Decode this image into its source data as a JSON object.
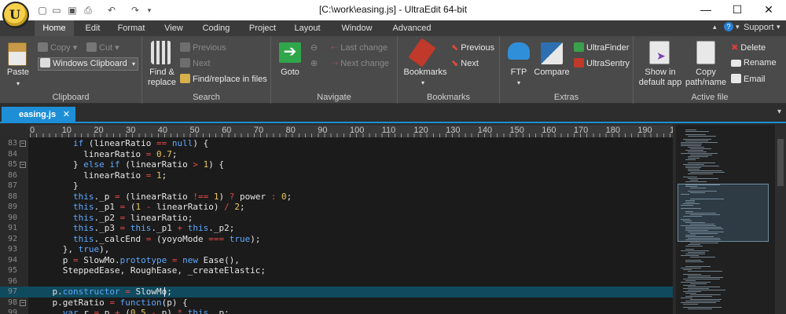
{
  "title_bar": {
    "title": "[C:\\work\\easing.js] - UltraEdit 64-bit",
    "app_logo_text": "U"
  },
  "ribbon_tabs": [
    "Home",
    "Edit",
    "Format",
    "View",
    "Coding",
    "Project",
    "Layout",
    "Window",
    "Advanced"
  ],
  "help": {
    "label": "?",
    "support": "Support"
  },
  "clipboard": {
    "paste": "Paste",
    "copy": "Copy",
    "cut": "Cut",
    "clipboard_select": "Windows Clipboard",
    "group": "Clipboard"
  },
  "search": {
    "find_replace_1": "Find &",
    "find_replace_2": "replace",
    "previous": "Previous",
    "next": "Next",
    "find_in_files": "Find/replace in files",
    "group": "Search"
  },
  "navigate": {
    "goto": "Goto",
    "last_change": "Last change",
    "next_change": "Next change",
    "group": "Navigate"
  },
  "bookmarks": {
    "bookmarks": "Bookmarks",
    "previous": "Previous",
    "next": "Next",
    "group": "Bookmarks"
  },
  "extras": {
    "ftp": "FTP",
    "compare": "Compare",
    "ultrafinder": "UltraFinder",
    "ultrasentry": "UltraSentry",
    "group": "Extras"
  },
  "active_file": {
    "show_1": "Show in",
    "show_2": "default app",
    "copy_1": "Copy",
    "copy_2": "path/name",
    "delete": "Delete",
    "rename": "Rename",
    "email": "Email",
    "group": "Active file"
  },
  "doc_tab": {
    "name": "easing.js",
    "close": "✕"
  },
  "ruler": [
    "0",
    "10",
    "20",
    "30",
    "40",
    "50",
    "60",
    "70",
    "80",
    "90",
    "100",
    "110",
    "120",
    "130",
    "140",
    "150",
    "160",
    "170",
    "180",
    "190",
    "1"
  ],
  "colors": {
    "accent": "#1e8fd6",
    "editor_bg": "#1b1b1b",
    "highlight": "#104a5e"
  },
  "code_lines": [
    {
      "n": "83",
      "html": "        <k>if</k> (linearRatio <o>==</o> <k>null</k>) {"
    },
    {
      "n": "84",
      "html": "          linearRatio <o>=</o> <nm>0.7</nm>;"
    },
    {
      "n": "85",
      "html": "        } <k>else if</k> (linearRatio <o>&gt;</o> <nm>1</nm>) {"
    },
    {
      "n": "86",
      "html": "          linearRatio <o>=</o> <nm>1</nm>;"
    },
    {
      "n": "87",
      "html": "        }"
    },
    {
      "n": "88",
      "html": "        <k>this</k>._p <o>=</o> (linearRatio <o>!==</o> <nm>1</nm>) <o>?</o> power <o>:</o> <nm>0</nm>;"
    },
    {
      "n": "89",
      "html": "        <k>this</k>._p1 <o>=</o> (<nm>1</nm> <o>-</o> linearRatio) <o>/</o> <nm>2</nm>;"
    },
    {
      "n": "90",
      "html": "        <k>this</k>._p2 <o>=</o> linearRatio;"
    },
    {
      "n": "91",
      "html": "        <k>this</k>._p3 <o>=</o> <k>this</k>._p1 <o>+</o> <k>this</k>._p2;"
    },
    {
      "n": "92",
      "html": "        <k>this</k>._calcEnd <o>=</o> (yoyoMode <o>===</o> <k>true</k>);"
    },
    {
      "n": "93",
      "html": "      }, <k>true</k>),"
    },
    {
      "n": "94",
      "html": "      p <o>=</o> SlowMo.<k>prototype</k> <o>=</o> <k>new</k> Ease(),"
    },
    {
      "n": "95",
      "html": "      SteppedEase, RoughEase, _createElastic;"
    },
    {
      "n": "96",
      "html": ""
    },
    {
      "n": "97",
      "html": "    p.<k>constructor</k> <o>=</o> SlowMo;"
    },
    {
      "n": "98",
      "html": "    p.getRatio <o>=</o> <k>function</k>(p) {"
    },
    {
      "n": "99",
      "html": "      <k>var</k> r <o>=</o> p <o>+</o> (<nm>0.5</nm> <o>-</o> p) <o>*</o> <k>this</k>._p;"
    }
  ]
}
